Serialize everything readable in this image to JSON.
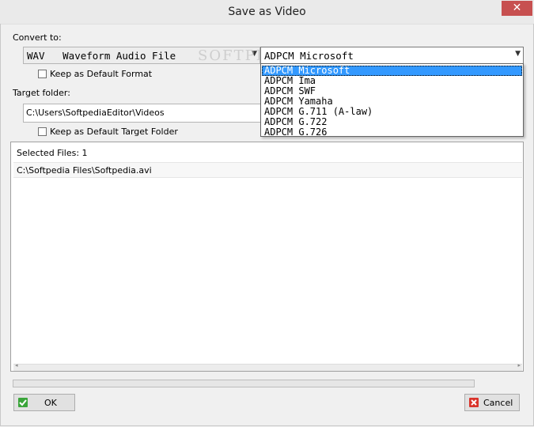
{
  "window": {
    "title": "Save as Video",
    "close_glyph": "✕"
  },
  "convert": {
    "label": "Convert to:",
    "format_value": "WAV   Waveform Audio File",
    "codec_value": "ADPCM Microsoft",
    "keep_default_label": "Keep as Default Format"
  },
  "codec_options": [
    "ADPCM Microsoft",
    "ADPCM Ima",
    "ADPCM SWF",
    "ADPCM Yamaha",
    "ADPCM G.711 (A-law)",
    "ADPCM G.722",
    "ADPCM G.726"
  ],
  "target": {
    "label": "Target folder:",
    "path": "C:\\Users\\SoftpediaEditor\\Videos",
    "keep_default_label": "Keep as Default Target Folder"
  },
  "files": {
    "header": "Selected Files: 1",
    "items": [
      "C:\\Softpedia Files\\Softpedia.avi"
    ]
  },
  "buttons": {
    "ok": "OK",
    "cancel": "Cancel"
  },
  "watermark": "SOFTPE",
  "colors": {
    "selection": "#3399ff",
    "close": "#c75050",
    "ok_icon": "#3aa53a",
    "cancel_icon": "#d9342b"
  }
}
